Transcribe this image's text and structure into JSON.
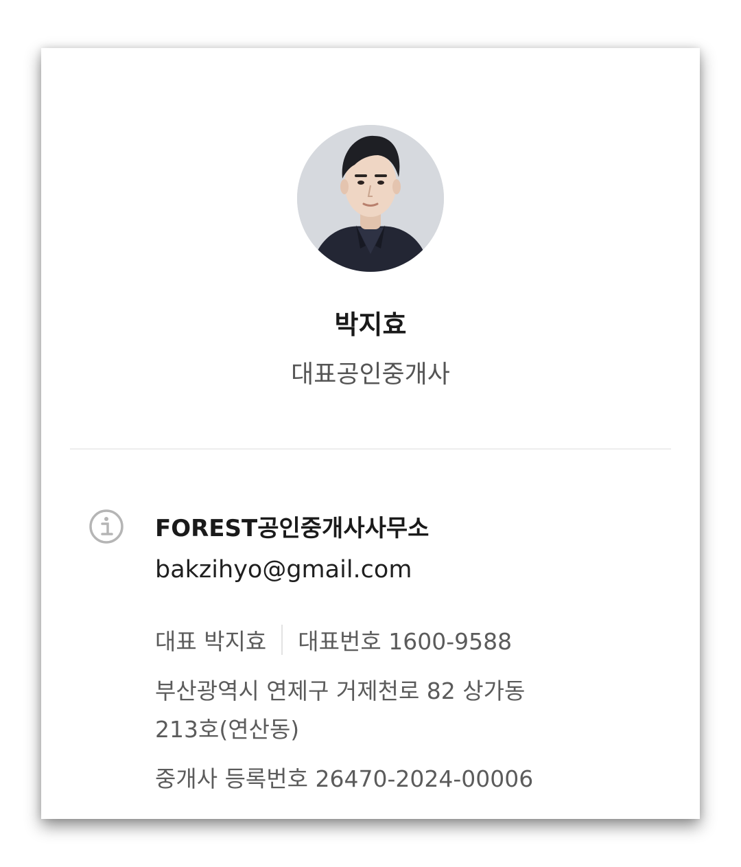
{
  "profile": {
    "name": "박지효",
    "role": "대표공인중개사",
    "avatar_icon": "profile-photo"
  },
  "info": {
    "icon": "info-icon",
    "company": "FOREST공인중개사사무소",
    "email": "bakzihyo@gmail.com",
    "representative": "대표 박지효",
    "phone": "대표번호 1600-9588",
    "address_line1": "부산광역시 연제구 거제천로 82 상가동",
    "address_line2": "213호(연산동)",
    "registration": "중개사 등록번호 26470-2024-00006"
  },
  "colors": {
    "primary_text": "#1a1a1a",
    "secondary_text": "#5b5b5b",
    "icon_gray": "#b5b5b5"
  }
}
